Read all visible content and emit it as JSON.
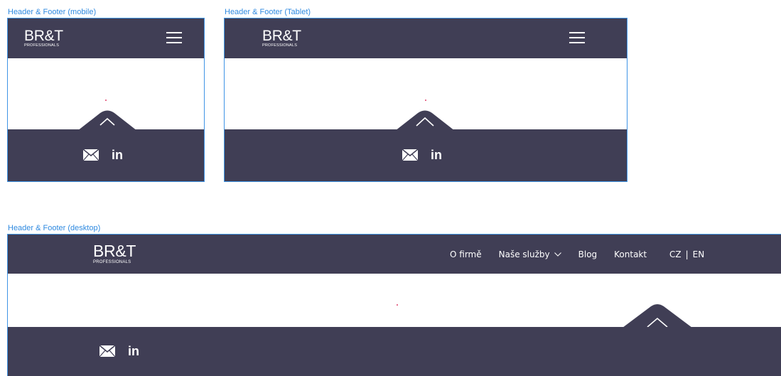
{
  "frames": {
    "mobile_label": "Header & Footer (mobile)",
    "tablet_label": "Header & Footer (Tablet)",
    "desktop_label": "Header & Footer (desktop)"
  },
  "brand": {
    "name": "BR&T",
    "tagline": "PROFESSIONALS"
  },
  "nav": {
    "items": [
      "O firmě",
      "Naše služby",
      "Blog",
      "Kontakt"
    ],
    "lang_cz": "CZ",
    "lang_sep": "|",
    "lang_en": "EN"
  },
  "social": {
    "linkedin": "in"
  },
  "icons": [
    "menu-icon",
    "chevron-up-icon",
    "chevron-down-icon",
    "envelope-icon",
    "linkedin-icon"
  ],
  "colors": {
    "bar": "#403e55",
    "frame_border": "#3f94e6",
    "label": "#2f8ae0",
    "accent_dot": "#e0406a"
  }
}
